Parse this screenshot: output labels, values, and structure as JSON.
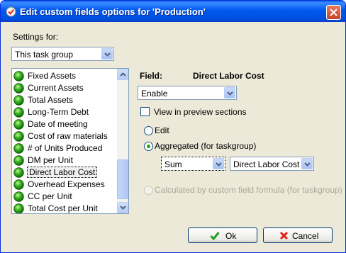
{
  "window": {
    "title": "Edit custom fields options for  'Production'",
    "close_icon": "close-icon",
    "app_icon": "check-shield-icon"
  },
  "settings": {
    "label": "Settings for:",
    "value": "This task group"
  },
  "list": {
    "items": [
      {
        "label": "Fixed Assets"
      },
      {
        "label": "Current Assets"
      },
      {
        "label": "Total Assets"
      },
      {
        "label": "Long-Term Debt"
      },
      {
        "label": "Date of meeting"
      },
      {
        "label": "Cost of raw materials"
      },
      {
        "label": "# of Units Produced"
      },
      {
        "label": "DM per Unit"
      },
      {
        "label": "Direct Labor Cost",
        "selected": true
      },
      {
        "label": "Overhead Expenses"
      },
      {
        "label": "CC per Unit"
      },
      {
        "label": "Total Cost per Unit"
      }
    ],
    "item_icon": "green-ball-icon"
  },
  "field": {
    "label": "Field:",
    "name": "Direct Labor Cost",
    "mode": "Enable",
    "preview_label": "View in preview sections",
    "preview_checked": false,
    "edit_label": "Edit",
    "aggregated_label": "Aggregated (for taskgroup)",
    "aggregated_checked": true,
    "agg_function": "Sum",
    "agg_field": "Direct Labor Cost",
    "formula_label": "Calculated by custom field formula (for taskgroup)"
  },
  "buttons": {
    "ok": "Ok",
    "cancel": "Cancel"
  },
  "colors": {
    "titlebar": "#0058EE",
    "window_bg": "#ECE9D8",
    "ok_check": "#21A121",
    "cancel_x": "#E0201B",
    "disabled_text": "#ACA899"
  }
}
